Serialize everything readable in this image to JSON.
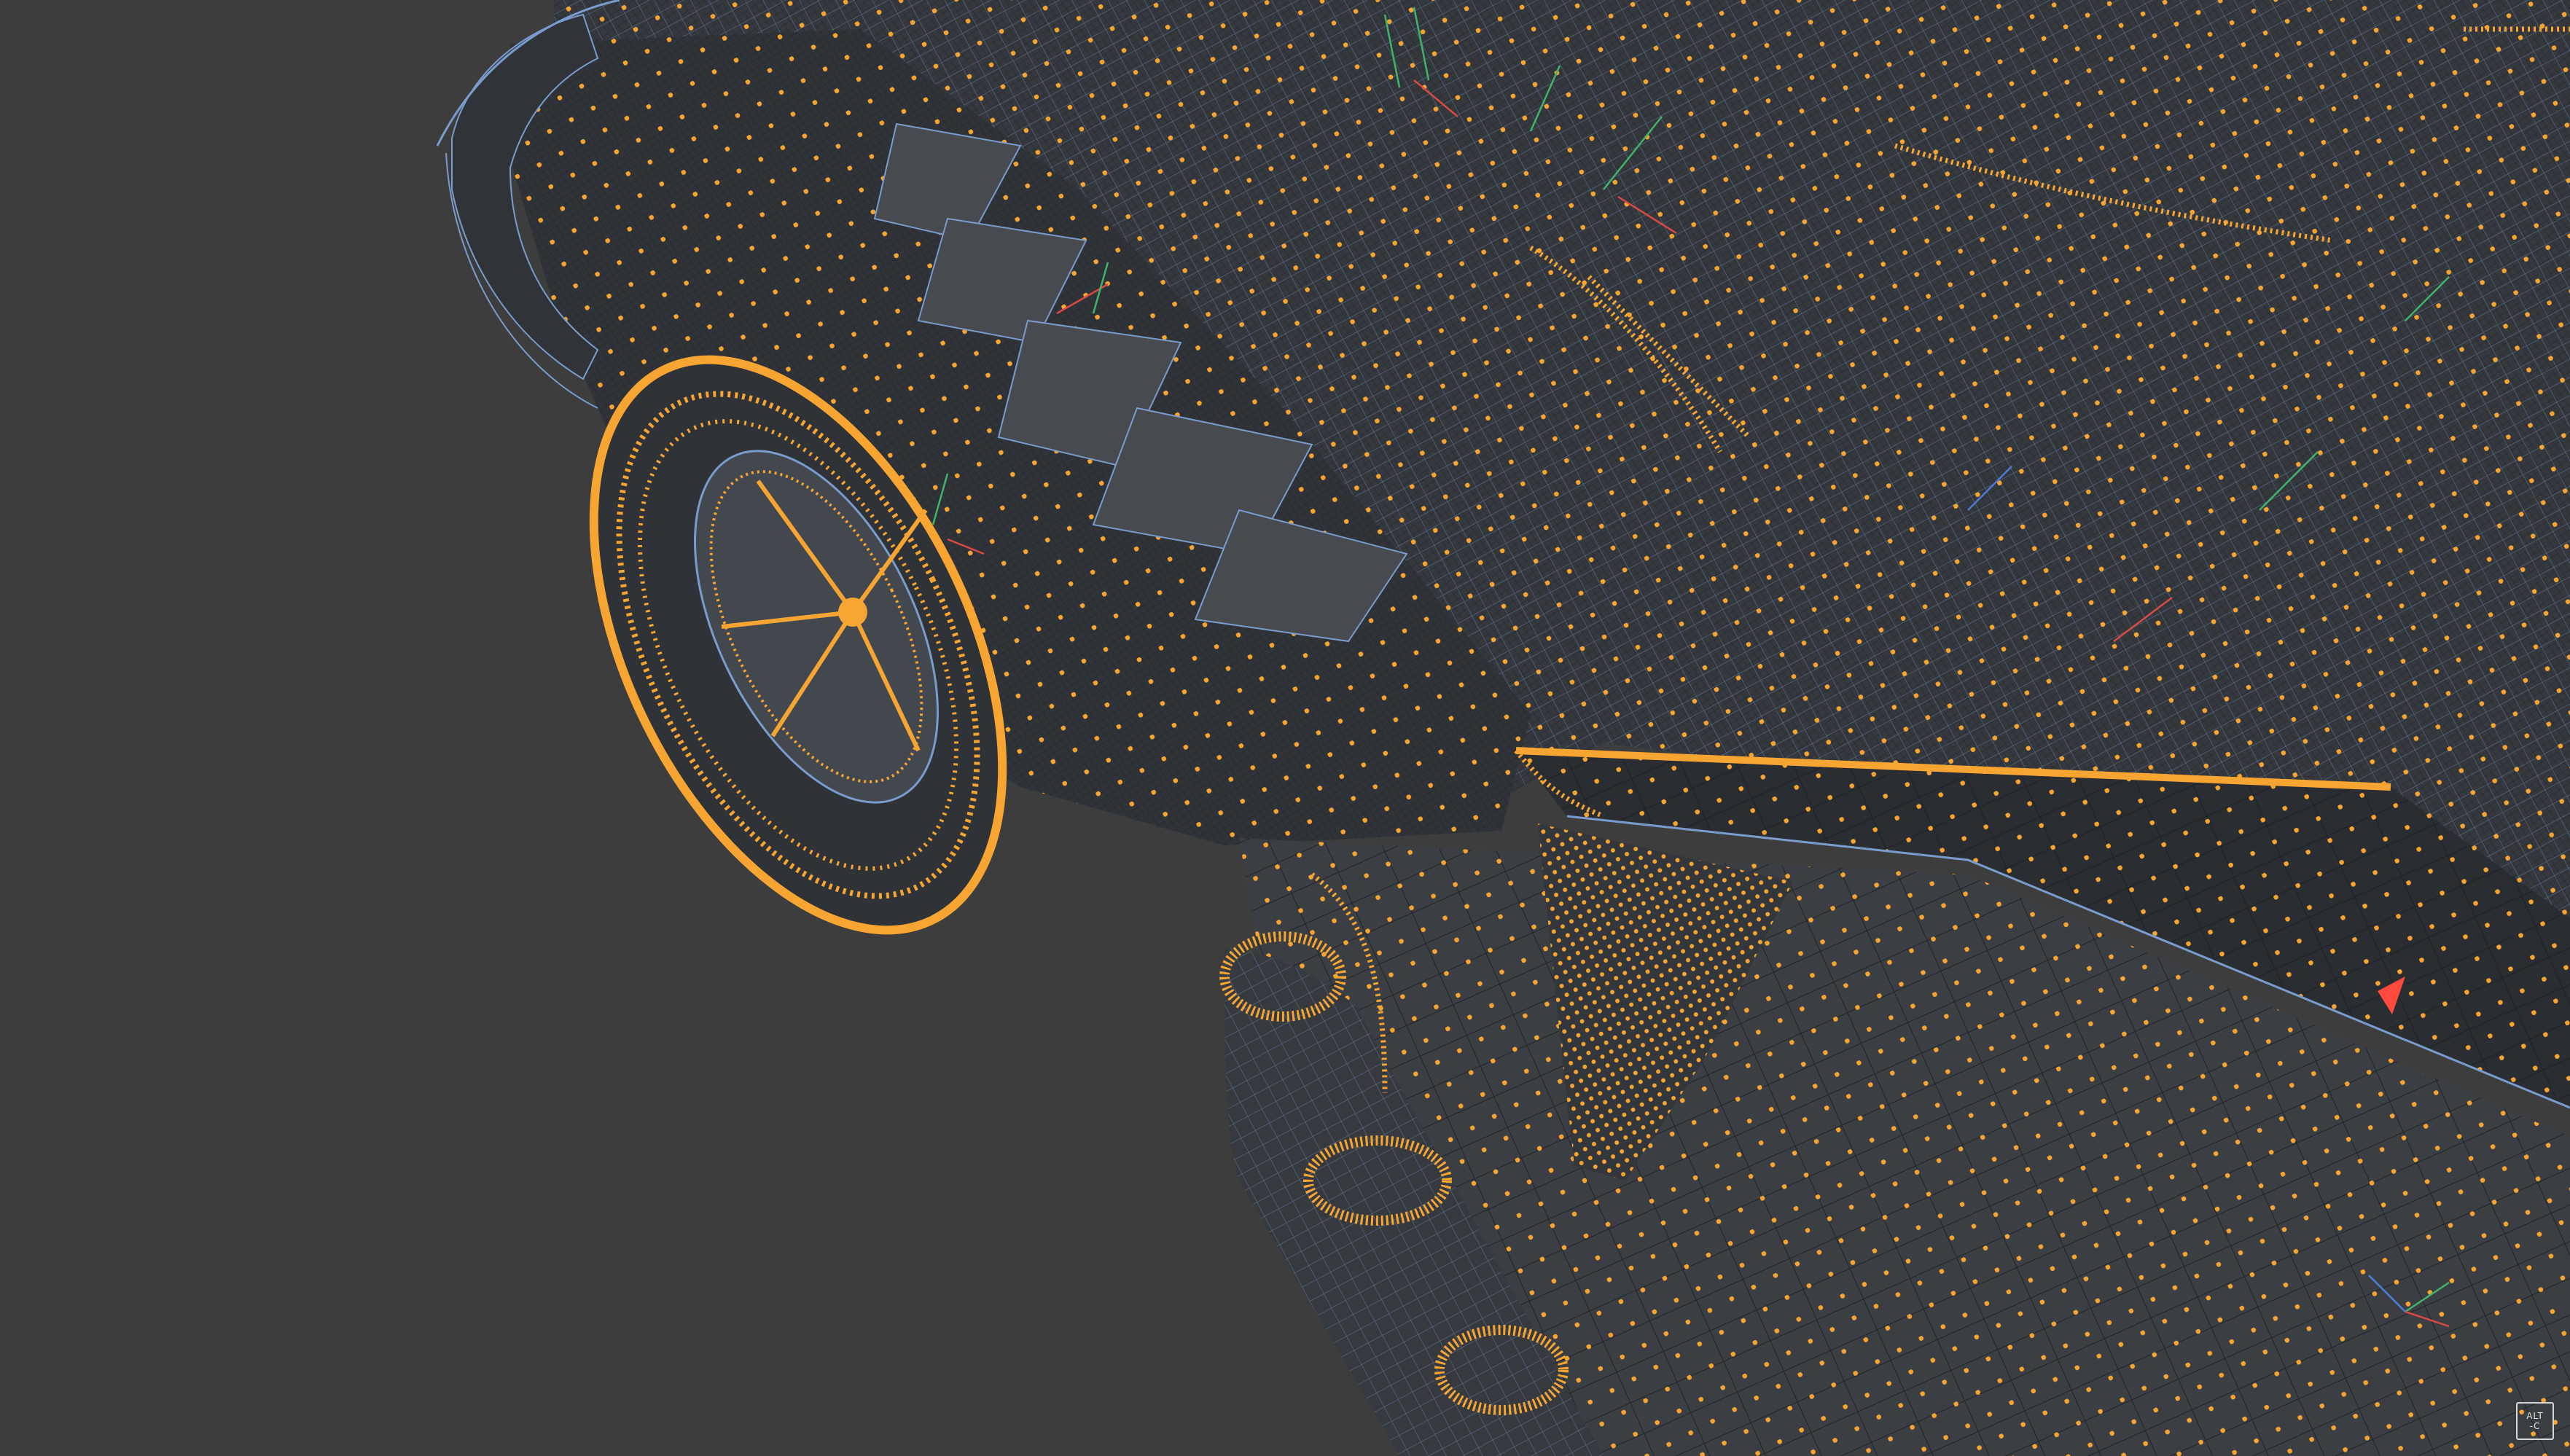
{
  "viewport": {
    "background_color": "#3d3d3d",
    "view_mode": "wireframe",
    "subject": "car-mesh-front-underside"
  },
  "colors": {
    "mesh_fill": "#35383d",
    "mesh_fill_light": "#474a4f",
    "wire_blue": "#7a9ccc",
    "wire_dark": "#22262c",
    "vertex_orange": "#f6a532",
    "normal_red": "#d94a45",
    "normal_green": "#3fb46a",
    "normal_blue": "#4c7bd8",
    "cursor_red": "#ff4a3d"
  },
  "icons": {
    "cursor": "red-3d-cursor-icon",
    "badge": "keyboard-shortcut-badge"
  },
  "shortcut_badge": {
    "line1": "ALT",
    "line2": "-C"
  }
}
